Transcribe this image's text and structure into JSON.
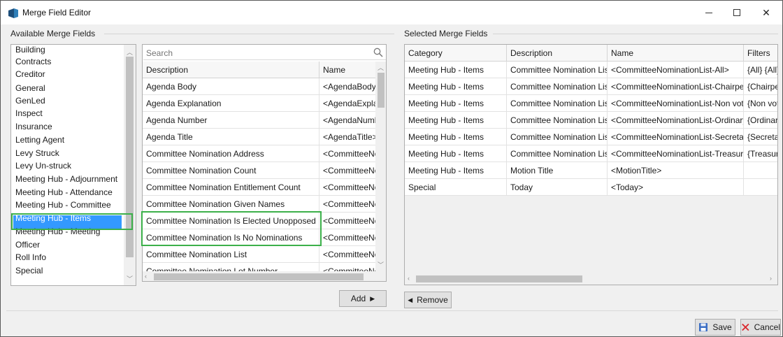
{
  "window": {
    "title": "Merge Field Editor",
    "controls": {
      "minimize": "—",
      "close": "✕"
    }
  },
  "available": {
    "group_label": "Available Merge Fields",
    "categories": [
      "Building",
      "Contracts",
      "Creditor",
      "General",
      "GenLed",
      "Inspect",
      "Insurance",
      "Letting Agent",
      "Levy Struck",
      "Levy Un-struck",
      "Meeting Hub - Adjournment",
      "Meeting Hub - Attendance",
      "Meeting Hub - Committee",
      "Meeting Hub - Items",
      "Meeting Hub - Meeting",
      "Officer",
      "Roll Info",
      "Special"
    ],
    "selected_category": "Meeting Hub - Items",
    "search": {
      "placeholder": "Search",
      "value": ""
    },
    "columns": {
      "description": "Description",
      "name": "Name"
    },
    "fields": [
      {
        "description": "Agenda Body",
        "name": "<AgendaBody>"
      },
      {
        "description": "Agenda Explanation",
        "name": "<AgendaExplanation>"
      },
      {
        "description": "Agenda Number",
        "name": "<AgendaNumber>"
      },
      {
        "description": "Agenda Title",
        "name": "<AgendaTitle>"
      },
      {
        "description": "Committee Nomination Address",
        "name": "<CommitteeNominationAddress>"
      },
      {
        "description": "Committee Nomination Count",
        "name": "<CommitteeNominationCount>"
      },
      {
        "description": "Committee Nomination Entitlement Count",
        "name": "<CommitteeNominationEntitlementCount>"
      },
      {
        "description": "Committee Nomination Given Names",
        "name": "<CommitteeNominationGivenNames>"
      },
      {
        "description": "Committee Nomination Is Elected Unopposed",
        "name": "<CommitteeNominationIsElectedUnopposed>"
      },
      {
        "description": "Committee Nomination Is No Nominations",
        "name": "<CommitteeNominationIsNoNominations>"
      },
      {
        "description": "Committee Nomination List",
        "name": "<CommitteeNominationList>"
      },
      {
        "description": "Committee Nomination Lot Number",
        "name": "<CommitteeNominationLotNumber>"
      }
    ],
    "add_button": "Add"
  },
  "selected": {
    "group_label": "Selected Merge Fields",
    "columns": {
      "category": "Category",
      "description": "Description",
      "name": "Name",
      "filters": "Filters"
    },
    "rows": [
      {
        "category": "Meeting Hub - Items",
        "description": "Committee Nomination List",
        "name": "<CommitteeNominationList-All>",
        "filters": "{All} {All}"
      },
      {
        "category": "Meeting Hub - Items",
        "description": "Committee Nomination List",
        "name": "<CommitteeNominationList-Chairperson>",
        "filters": "{Chairperson}"
      },
      {
        "category": "Meeting Hub - Items",
        "description": "Committee Nomination List",
        "name": "<CommitteeNominationList-Non voting>",
        "filters": "{Non voting}"
      },
      {
        "category": "Meeting Hub - Items",
        "description": "Committee Nomination List",
        "name": "<CommitteeNominationList-Ordinary>",
        "filters": "{Ordinary}"
      },
      {
        "category": "Meeting Hub - Items",
        "description": "Committee Nomination List",
        "name": "<CommitteeNominationList-Secretary>",
        "filters": "{Secretary}"
      },
      {
        "category": "Meeting Hub - Items",
        "description": "Committee Nomination List",
        "name": "<CommitteeNominationList-Treasurer>",
        "filters": "{Treasurer}"
      },
      {
        "category": "Meeting Hub - Items",
        "description": "Motion Title",
        "name": "<MotionTitle>",
        "filters": ""
      },
      {
        "category": "Special",
        "description": "Today",
        "name": "<Today>",
        "filters": ""
      }
    ],
    "remove_button": "Remove"
  },
  "footer": {
    "save": "Save",
    "cancel": "Cancel"
  },
  "colors": {
    "selection": "#3399ff",
    "highlight": "#3cb04a",
    "cancel_x": "#d9262c",
    "save_icon": "#3b6ec4"
  }
}
